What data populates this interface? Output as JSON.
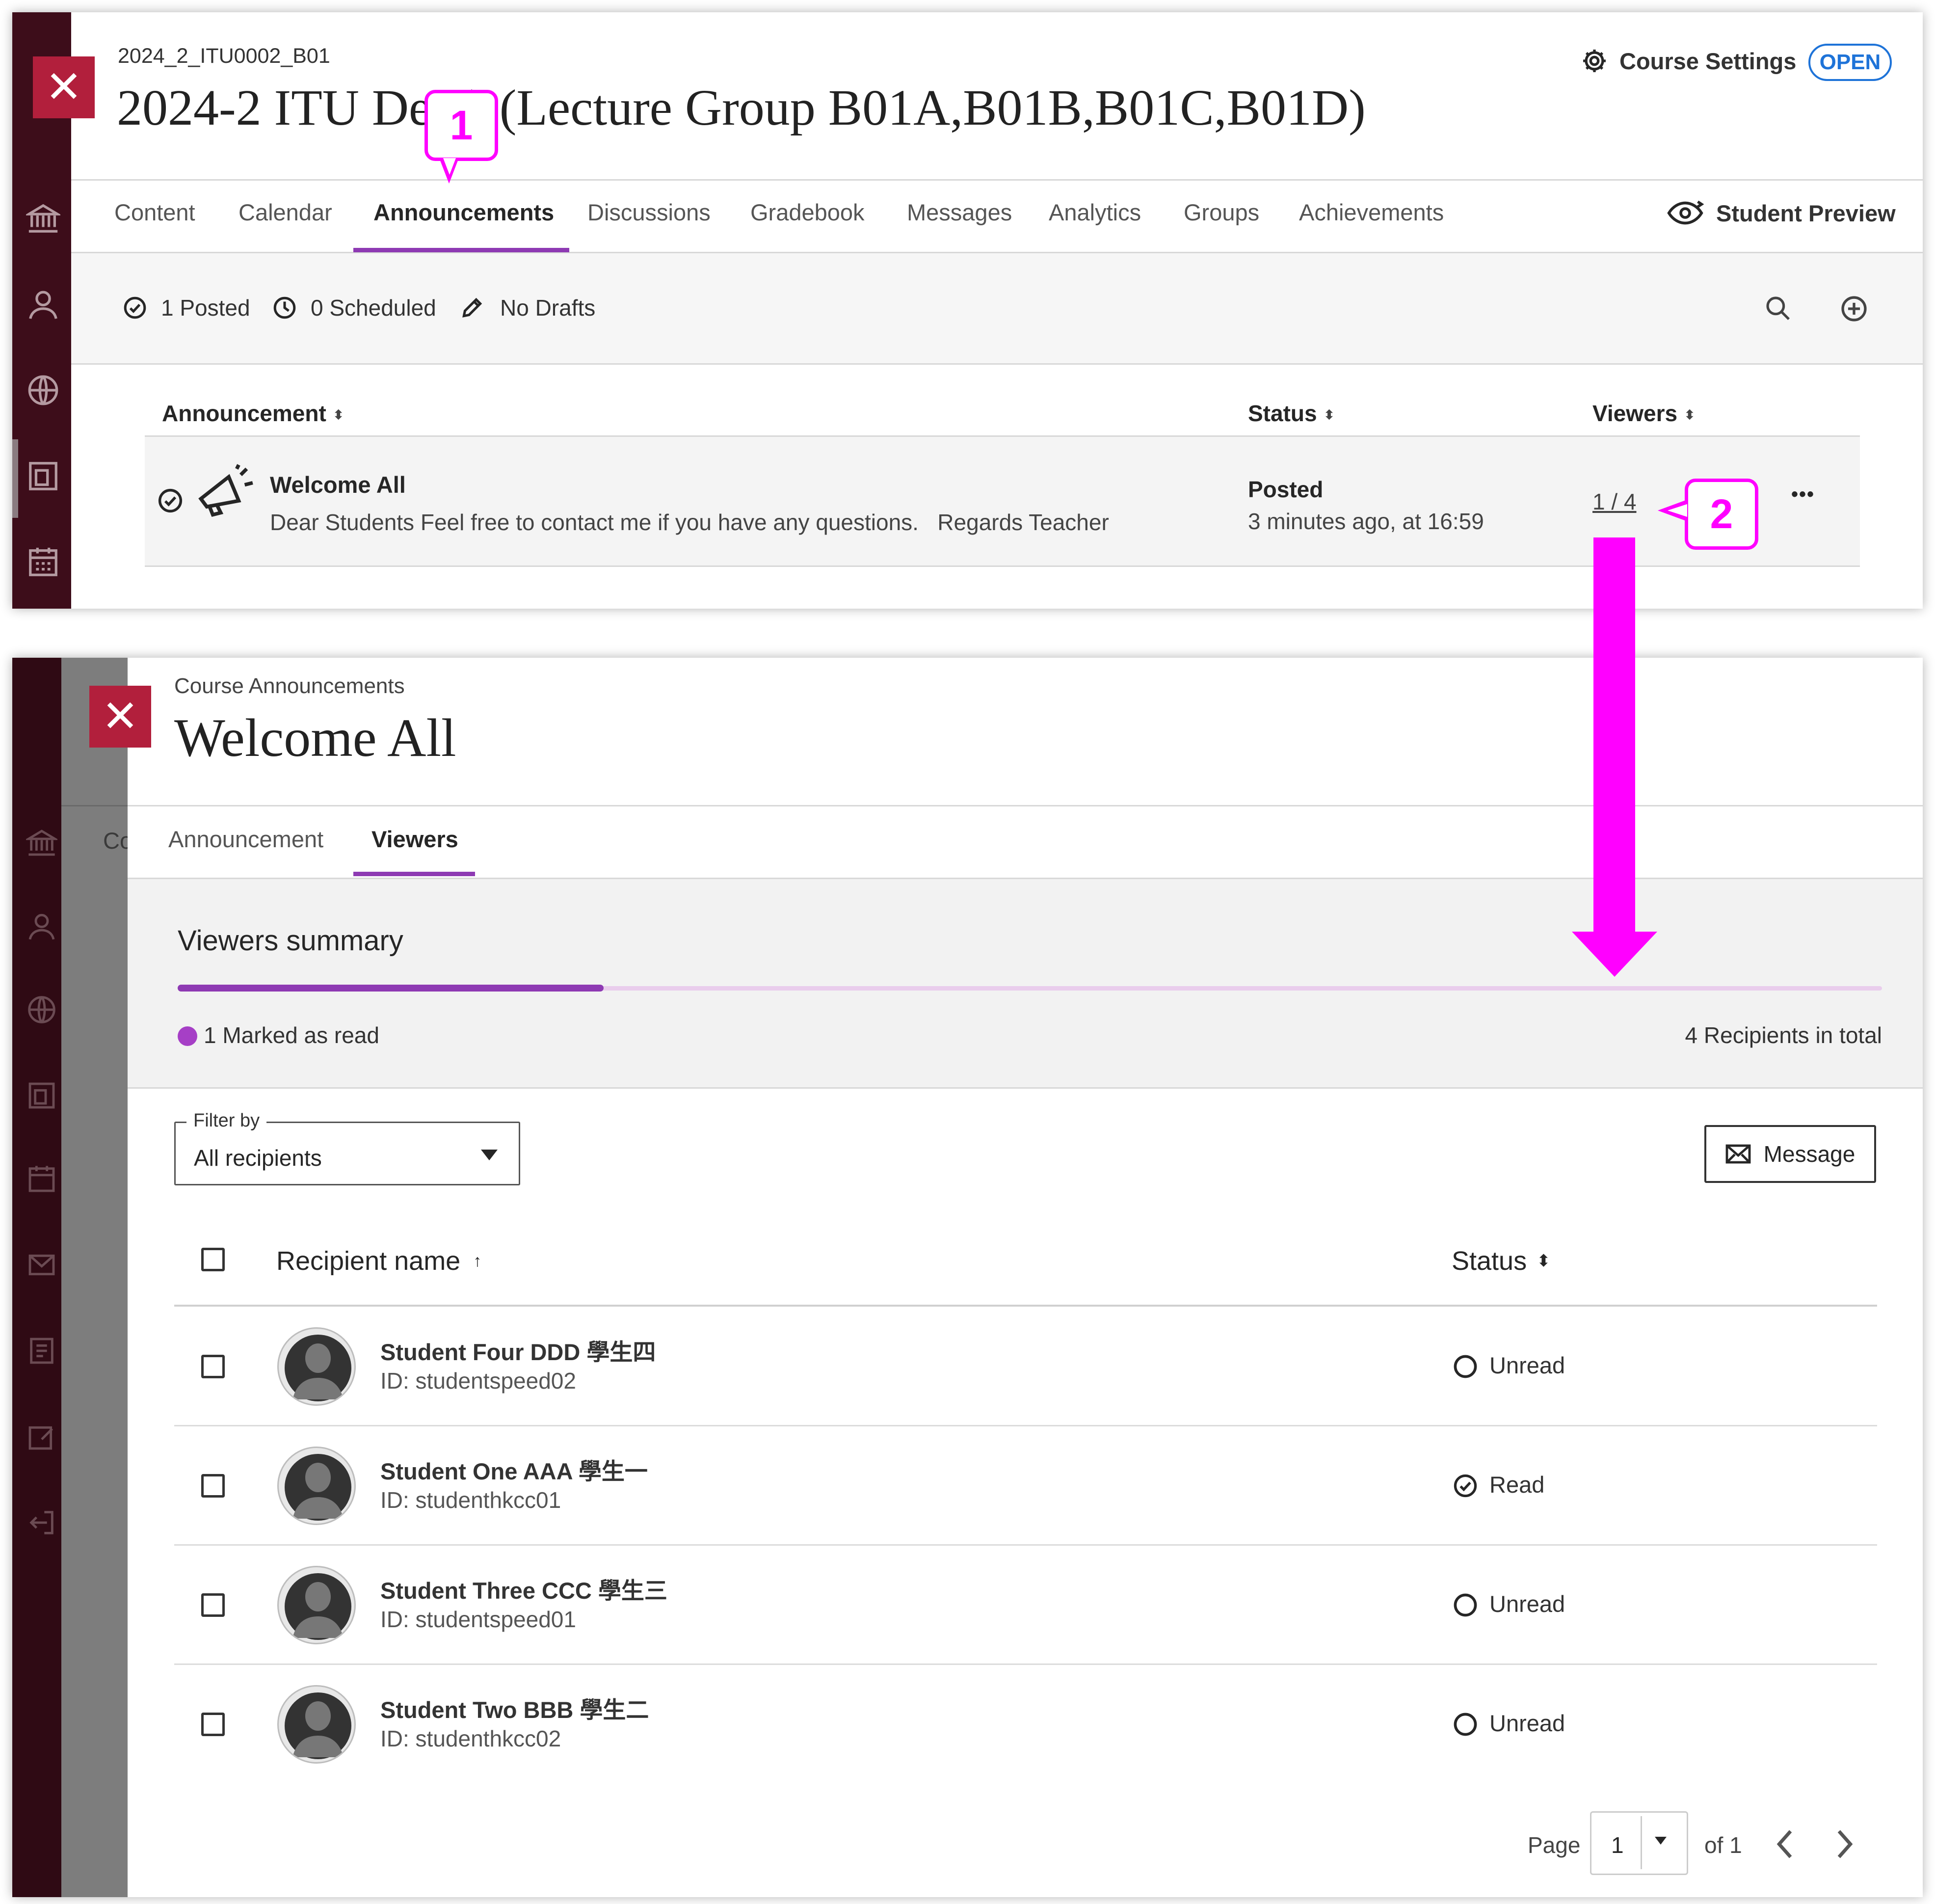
{
  "top": {
    "course_id": "2024_2_ITU0002_B01",
    "course_title": "2024-2 ITU De   ) (Lecture Group B01A,B01B,B01C,B01D)",
    "settings_label": "Course Settings",
    "open_badge": "OPEN",
    "tabs": [
      {
        "label": "Content"
      },
      {
        "label": "Calendar"
      },
      {
        "label": "Announcements"
      },
      {
        "label": "Discussions"
      },
      {
        "label": "Gradebook"
      },
      {
        "label": "Messages"
      },
      {
        "label": "Analytics"
      },
      {
        "label": "Groups"
      },
      {
        "label": "Achievements"
      }
    ],
    "student_preview": "Student Preview",
    "summary": {
      "posted": "1 Posted",
      "scheduled": "0 Scheduled",
      "drafts": "No Drafts"
    },
    "table": {
      "col_announcement": "Announcement",
      "col_status": "Status",
      "col_viewers": "Viewers",
      "row": {
        "title": "Welcome All",
        "body": "Dear Students Feel free to contact me if you have any questions.   Regards Teacher",
        "status": "Posted",
        "time": "3 minutes ago, at 16:59",
        "viewers": "1 / 4",
        "more": "•••"
      }
    }
  },
  "callouts": {
    "one": "1",
    "two": "2"
  },
  "detail": {
    "breadcrumb": "Course Announcements",
    "title": "Welcome All",
    "behind_text": "Co",
    "tabs": [
      {
        "label": "Announcement"
      },
      {
        "label": "Viewers"
      }
    ],
    "summary_title": "Viewers summary",
    "read_fraction": 0.25,
    "marked_read": "1 Marked as read",
    "recipients_total": "4 Recipients in total",
    "filter_label": "Filter by",
    "filter_value": "All recipients",
    "message_button": "Message",
    "col_recipient": "Recipient name",
    "col_status": "Status",
    "recipients": [
      {
        "name": "Student Four DDD 學生四",
        "id": "ID: studentspeed02",
        "status": "Unread"
      },
      {
        "name": "Student One AAA 學生一",
        "id": "ID: studenthkcc01",
        "status": "Read"
      },
      {
        "name": "Student Three CCC 學生三",
        "id": "ID: studentspeed01",
        "status": "Unread"
      },
      {
        "name": "Student Two BBB 學生二",
        "id": "ID: studenthkcc02",
        "status": "Unread"
      }
    ],
    "pagination": {
      "page_label": "Page",
      "page_value": "1",
      "of_label": "of 1"
    }
  },
  "colors": {
    "accent": "#8e3ab3",
    "callout": "#ff00ff",
    "close": "#b21f3c",
    "rail": "#3d0d1a"
  }
}
